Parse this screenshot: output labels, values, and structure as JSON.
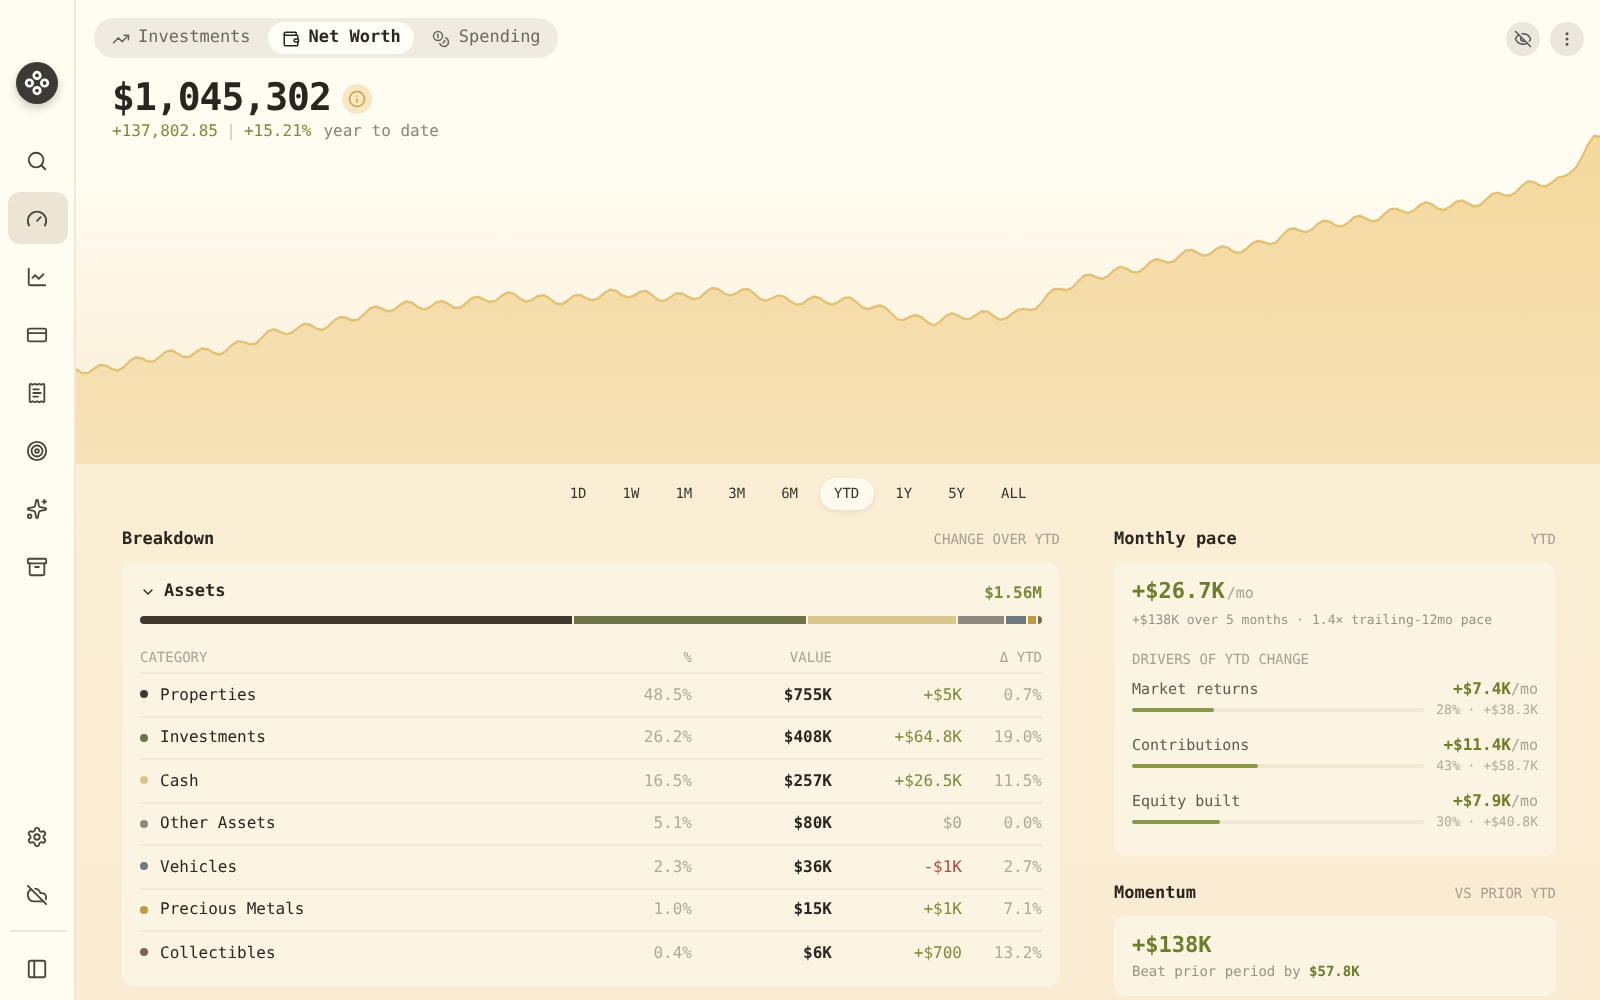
{
  "sidebar": {
    "items": [
      {
        "kind": "search",
        "selected": false
      },
      {
        "kind": "dashboard",
        "selected": true
      },
      {
        "kind": "chart",
        "selected": false
      },
      {
        "kind": "card",
        "selected": false
      },
      {
        "kind": "receipt",
        "selected": false
      },
      {
        "kind": "target",
        "selected": false
      },
      {
        "kind": "sparkles",
        "selected": false
      },
      {
        "kind": "archive",
        "selected": false
      }
    ],
    "bottom_items": [
      {
        "kind": "settings"
      },
      {
        "kind": "hide"
      },
      {
        "kind": "panel"
      }
    ]
  },
  "tabs": [
    {
      "label": "Investments",
      "selected": false
    },
    {
      "label": "Net Worth",
      "selected": true
    },
    {
      "label": "Spending",
      "selected": false
    }
  ],
  "header": {
    "value": "$1,045,302",
    "change": "+137,802.85",
    "percent": "+15.21%",
    "period": "year to date"
  },
  "ranges": [
    {
      "label": "1D",
      "selected": false
    },
    {
      "label": "1W",
      "selected": false
    },
    {
      "label": "1M",
      "selected": false
    },
    {
      "label": "3M",
      "selected": false
    },
    {
      "label": "6M",
      "selected": false
    },
    {
      "label": "YTD",
      "selected": true
    },
    {
      "label": "1Y",
      "selected": false
    },
    {
      "label": "5Y",
      "selected": false
    },
    {
      "label": "ALL",
      "selected": false
    }
  ],
  "breakdown": {
    "title": "Breakdown",
    "caption": "CHANGE OVER YTD",
    "group": {
      "label": "Assets",
      "total": "$1.56M",
      "expanded": true
    },
    "columns": [
      "CATEGORY",
      "%",
      "VALUE",
      "Δ YTD"
    ],
    "rows": [
      {
        "name": "Properties",
        "color": "#3f382d",
        "percent": "48.5%",
        "value": "$755K",
        "delta": {
          "text": "+$5K",
          "color": "#7c8a3a"
        },
        "delta_pct": "0.7%"
      },
      {
        "name": "Investments",
        "color": "#6e7445",
        "percent": "26.2%",
        "value": "$408K",
        "delta": {
          "text": "+$64.8K",
          "color": "#7c8a3a"
        },
        "delta_pct": "19.0%"
      },
      {
        "name": "Cash",
        "color": "#d8c88e",
        "percent": "16.5%",
        "value": "$257K",
        "delta": {
          "text": "+$26.5K",
          "color": "#7c8a3a"
        },
        "delta_pct": "11.5%"
      },
      {
        "name": "Other Assets",
        "color": "#8f8a80",
        "percent": "5.1%",
        "value": "$80K",
        "delta": {
          "text": "$0",
          "color": "#aaa395"
        },
        "delta_pct": "0.0%"
      },
      {
        "name": "Vehicles",
        "color": "#6f7a80",
        "percent": "2.3%",
        "value": "$36K",
        "delta": {
          "text": "-$1K",
          "color": "#c0463c"
        },
        "delta_pct": "2.7%"
      },
      {
        "name": "Precious Metals",
        "color": "#c29a3e",
        "percent": "1.0%",
        "value": "$15K",
        "delta": {
          "text": "+$1K",
          "color": "#7c8a3a"
        },
        "delta_pct": "7.1%"
      },
      {
        "name": "Collectibles",
        "color": "#7b6650",
        "percent": "0.4%",
        "value": "$6K",
        "delta": {
          "text": "+$700",
          "color": "#7c8a3a"
        },
        "delta_pct": "13.2%"
      }
    ]
  },
  "monthly_pace": {
    "title": "Monthly pace",
    "caption": "YTD",
    "value": "+$26.7K",
    "unit": "/mo",
    "summary": "+$138K over 5 months · 1.4× trailing-12mo pace",
    "drivers_title": "DRIVERS OF YTD CHANGE",
    "drivers": [
      {
        "name": "Market returns",
        "value": "+$7.4K",
        "unit": "/mo",
        "level": 0.28,
        "detail": "28% · +$38.3K"
      },
      {
        "name": "Contributions",
        "value": "+$11.4K",
        "unit": "/mo",
        "level": 0.43,
        "detail": "43% · +$58.7K"
      },
      {
        "name": "Equity built",
        "value": "+$7.9K",
        "unit": "/mo",
        "level": 0.3,
        "detail": "30% · +$40.8K"
      }
    ]
  },
  "momentum": {
    "title": "Momentum",
    "caption": "VS PRIOR YTD",
    "value": "+$138K",
    "note": "Beat prior period by **$57.8K**"
  }
}
